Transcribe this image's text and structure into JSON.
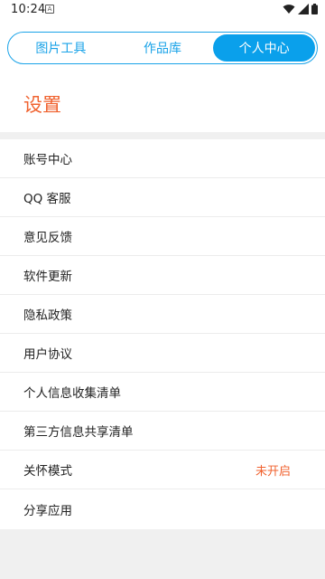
{
  "status_bar": {
    "time": "10:24",
    "notification_glyph": "A"
  },
  "tabs": [
    {
      "label": "图片工具",
      "active": false
    },
    {
      "label": "作品库",
      "active": false
    },
    {
      "label": "个人中心",
      "active": true
    }
  ],
  "header": {
    "title": "设置"
  },
  "settings": [
    {
      "label": "账号中心",
      "value": ""
    },
    {
      "label": "QQ 客服",
      "value": ""
    },
    {
      "label": "意见反馈",
      "value": ""
    },
    {
      "label": "软件更新",
      "value": ""
    },
    {
      "label": "隐私政策",
      "value": ""
    },
    {
      "label": "用户协议",
      "value": ""
    },
    {
      "label": "个人信息收集清单",
      "value": ""
    },
    {
      "label": "第三方信息共享清单",
      "value": ""
    },
    {
      "label": "关怀模式",
      "value": "未开启"
    },
    {
      "label": "分享应用",
      "value": ""
    }
  ],
  "colors": {
    "accent_blue": "#0aa0eb",
    "accent_orange": "#f0622f"
  },
  "icons": {
    "wifi": "wifi-icon",
    "signal": "signal-icon",
    "battery": "battery-icon"
  }
}
